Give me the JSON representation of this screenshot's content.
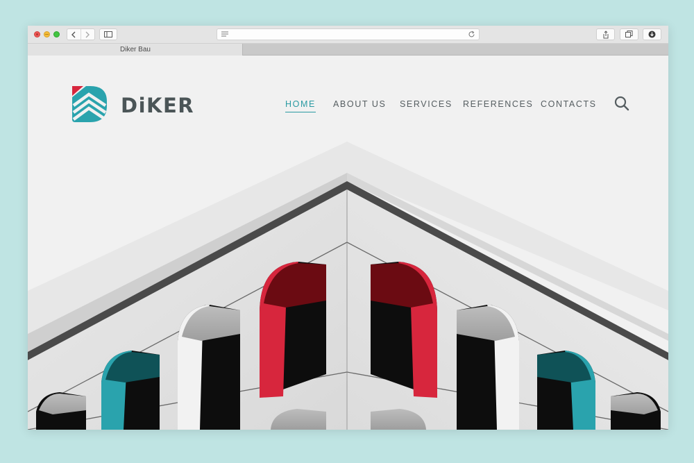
{
  "browser": {
    "tab_title": "Diker Bau",
    "url": ""
  },
  "site": {
    "brand": "DiKER",
    "nav": [
      {
        "label": "HOME",
        "active": true
      },
      {
        "label": "ABOUT US",
        "active": false
      },
      {
        "label": "SERVICES",
        "active": false
      },
      {
        "label": "REFERENCES",
        "active": false
      },
      {
        "label": "CONTACTS",
        "active": false
      }
    ]
  },
  "icons": {
    "search": "search-icon",
    "logo": "diker-logo-icon"
  },
  "colors": {
    "accent": "#2a9aa2",
    "brand_red": "#d7263d",
    "brand_teal": "#2aa3ad",
    "text_dark": "#4b5557",
    "background": "#bfe4e3"
  }
}
